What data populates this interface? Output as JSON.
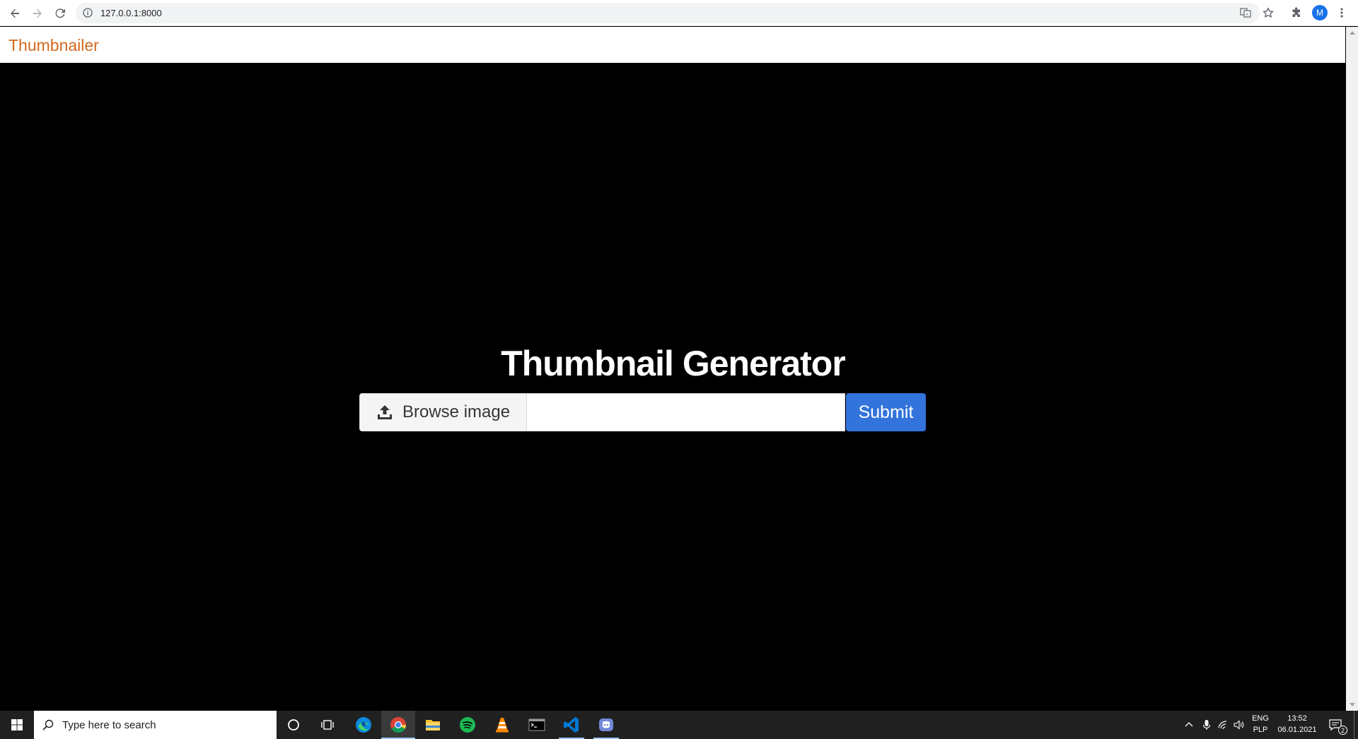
{
  "browser": {
    "url": "127.0.0.1:8000",
    "profile_initial": "M"
  },
  "page": {
    "brand": "Thumbnailer",
    "title": "Thumbnail Generator",
    "browse_label": "Browse image",
    "file_name": "",
    "submit_label": "Submit"
  },
  "taskbar": {
    "search_placeholder": "Type here to search",
    "lang_top": "ENG",
    "lang_bottom": "PLP",
    "time": "13:52",
    "date": "06.01.2021",
    "notification_count": "2"
  },
  "colors": {
    "brand": "#d2691e",
    "submit": "#3273dc",
    "hero_bg": "#000000"
  }
}
